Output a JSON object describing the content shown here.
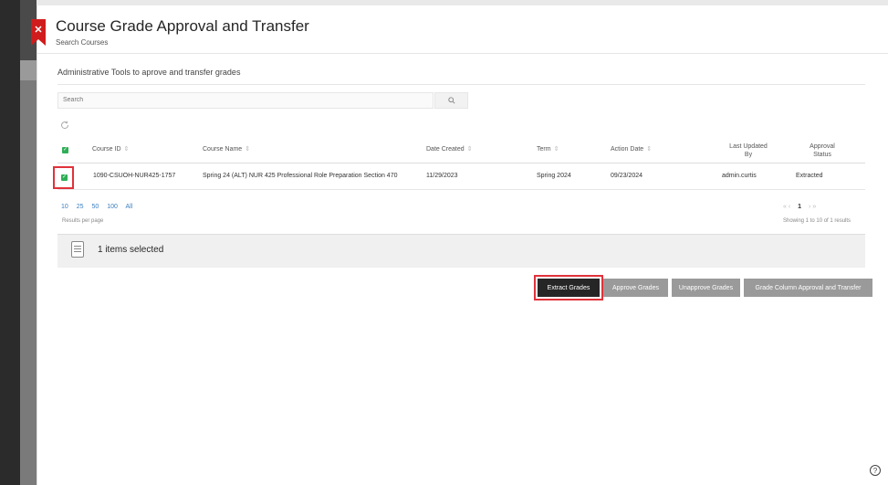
{
  "header": {
    "title": "Course Grade Approval and Transfer",
    "subtitle": "Search Courses",
    "close_glyph": "✕"
  },
  "description": "Administrative Tools to aprove and transfer grades",
  "search": {
    "placeholder": "Search",
    "icon": "search-icon"
  },
  "table": {
    "columns": [
      {
        "label": "Course ID"
      },
      {
        "label": "Course Name"
      },
      {
        "label": "Date Created"
      },
      {
        "label": "Term"
      },
      {
        "label": "Action Date"
      },
      {
        "label_1": "Last Updated",
        "label_2": "By"
      },
      {
        "label_1": "Approval",
        "label_2": "Status"
      }
    ],
    "rows": [
      {
        "course_id": "1090-CSUOH-NUR425-1757",
        "course_name": "Spring 24 (ALT) NUR 425 Professional Role Preparation Section 470",
        "date_created": "11/29/2023",
        "term": "Spring 2024",
        "action_date": "09/23/2024",
        "last_updated_by": "admin.curtis",
        "approval_status": "Extracted"
      }
    ]
  },
  "pagination": {
    "sizes": [
      "10",
      "25",
      "50",
      "100",
      "All"
    ],
    "per_page_label": "Results per page",
    "current_page": "1",
    "showing": "Showing 1 to 10 of 1 results"
  },
  "selection": {
    "text": "1 items selected"
  },
  "actions": {
    "extract": "Extract Grades",
    "approve": "Approve Grades",
    "unapprove": "Unapprove Grades",
    "grade_column": "Grade Column Approval and Transfer"
  },
  "colors": {
    "accent_red": "#d01c1c",
    "checkbox_green": "#2fae57",
    "link_blue": "#3a7fc1"
  },
  "help": {
    "glyph": "?"
  }
}
